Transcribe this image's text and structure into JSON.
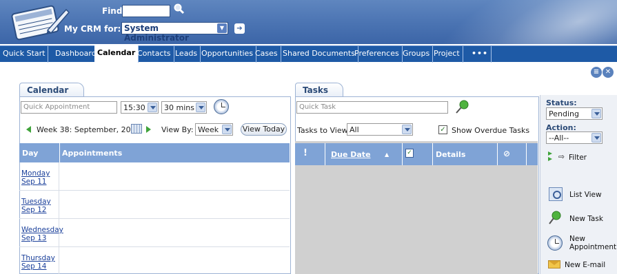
{
  "header": {
    "find_label": "Find:",
    "mycrm_label": "My CRM for:",
    "user": "System Administrator"
  },
  "tabs": [
    "Quick Start",
    "Dashboard",
    "Calendar",
    "Contacts",
    "Leads",
    "Opportunities",
    "Cases",
    "Shared Documents",
    "Preferences",
    "Groups",
    "Project",
    "•••"
  ],
  "active_tab": "Calendar",
  "calendar": {
    "title": "Calendar",
    "quick_placeholder": "Quick Appointment",
    "time": "15:30",
    "duration": "30 mins",
    "week_label": "Week 38: September, 2006",
    "view_by_label": "View By:",
    "view_by": "Week",
    "view_today": "View Today",
    "col_day": "Day",
    "col_appointments": "Appointments",
    "days": [
      {
        "name": "Monday",
        "date": "Sep 11"
      },
      {
        "name": "Tuesday",
        "date": "Sep 12"
      },
      {
        "name": "Wednesday",
        "date": "Sep 13"
      },
      {
        "name": "Thursday",
        "date": "Sep 14"
      }
    ]
  },
  "tasks": {
    "title": "Tasks",
    "quick_placeholder": "Quick Task",
    "view_label": "Tasks to View:",
    "view_value": "All",
    "overdue_label": "Show Overdue Tasks",
    "overdue_checked": true,
    "col_priority": "!",
    "col_due": "Due Date",
    "col_details": "Details"
  },
  "sidebar": {
    "status_label": "Status:",
    "status_value": "Pending",
    "action_label": "Action:",
    "action_value": "--All--",
    "filter": "Filter",
    "list_view": "List View",
    "new_task": "New Task",
    "new_appointment_1": "New",
    "new_appointment_2": "Appointment",
    "new_email": "New E-mail"
  },
  "colors": {
    "header": "#4a73b2",
    "tabbar": "#1e5aa6",
    "table_header": "#7fa3d6",
    "link": "#1a3f9a"
  }
}
